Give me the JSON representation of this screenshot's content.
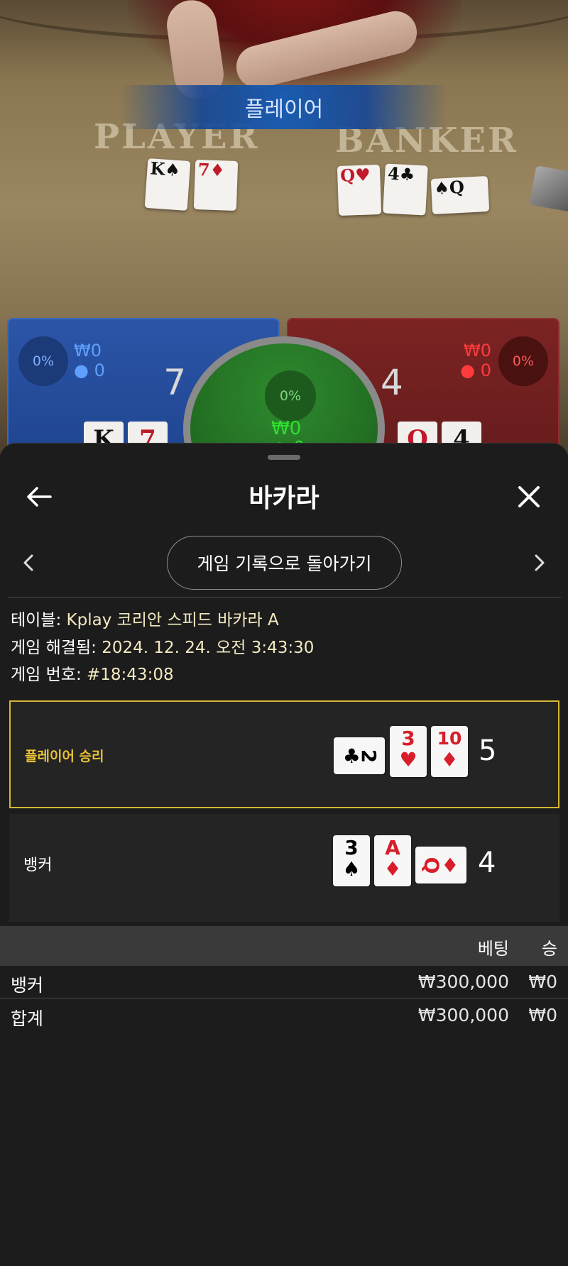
{
  "stage": {
    "banner": "플레이어",
    "felt_player": "PLAYER",
    "felt_banker": "BANKER",
    "player_cards": [
      {
        "rank": "K",
        "suit": "♠",
        "color": "black"
      },
      {
        "rank": "7",
        "suit": "♦",
        "color": "red"
      }
    ],
    "banker_cards": [
      {
        "rank": "Q",
        "suit": "♥",
        "color": "red"
      },
      {
        "rank": "4",
        "suit": "♣",
        "color": "black"
      },
      {
        "rank": "Q",
        "suit": "♠",
        "color": "black"
      }
    ],
    "player_panel": {
      "pct": "0%",
      "amount": "₩0",
      "count": "0",
      "score": "7",
      "cards": [
        "K",
        "7"
      ]
    },
    "banker_panel": {
      "pct": "0%",
      "amount": "₩0",
      "count": "0",
      "score": "4",
      "cards": [
        "Q",
        "4"
      ]
    },
    "tie_panel": {
      "pct": "0%",
      "amount": "₩0",
      "count": "0"
    }
  },
  "sheet": {
    "title": "바카라",
    "back_icon": "arrow-left-icon",
    "close_icon": "close-icon",
    "history_button": "게임 기록으로 돌아가기",
    "info": {
      "table_key": "테이블:",
      "table_val": "Kplay 코리안 스피드 바카라 A",
      "resolved_key": "게임 해결됨:",
      "resolved_val": "2024. 12. 24. 오전 3:43:30",
      "number_key": "게임 번호:",
      "number_val": "#18:43:08"
    },
    "results": {
      "player": {
        "label": "플레이어 승리",
        "total": "5",
        "cards": [
          {
            "rank": "2",
            "suit": "♣",
            "color": "black",
            "side": true
          },
          {
            "rank": "3",
            "suit": "♥",
            "color": "red",
            "side": false
          },
          {
            "rank": "10",
            "suit": "♦",
            "color": "red",
            "side": false
          }
        ]
      },
      "banker": {
        "label": "뱅커",
        "total": "4",
        "cards": [
          {
            "rank": "3",
            "suit": "♠",
            "color": "black",
            "side": false
          },
          {
            "rank": "A",
            "suit": "♦",
            "color": "red",
            "side": false
          },
          {
            "rank": "Q",
            "suit": "♦",
            "color": "red",
            "side": true
          }
        ]
      }
    },
    "bets": {
      "header_bet": "베팅",
      "header_win": "승",
      "rows": [
        {
          "name": "뱅커",
          "bet": "₩300,000",
          "win": "₩0"
        },
        {
          "name": "합계",
          "bet": "₩300,000",
          "win": "₩0"
        }
      ]
    }
  },
  "colors": {
    "player_accent": "#2c55a8",
    "banker_accent": "#7b2323",
    "winner_border": "#d5b72e",
    "winner_text": "#e8c233"
  }
}
